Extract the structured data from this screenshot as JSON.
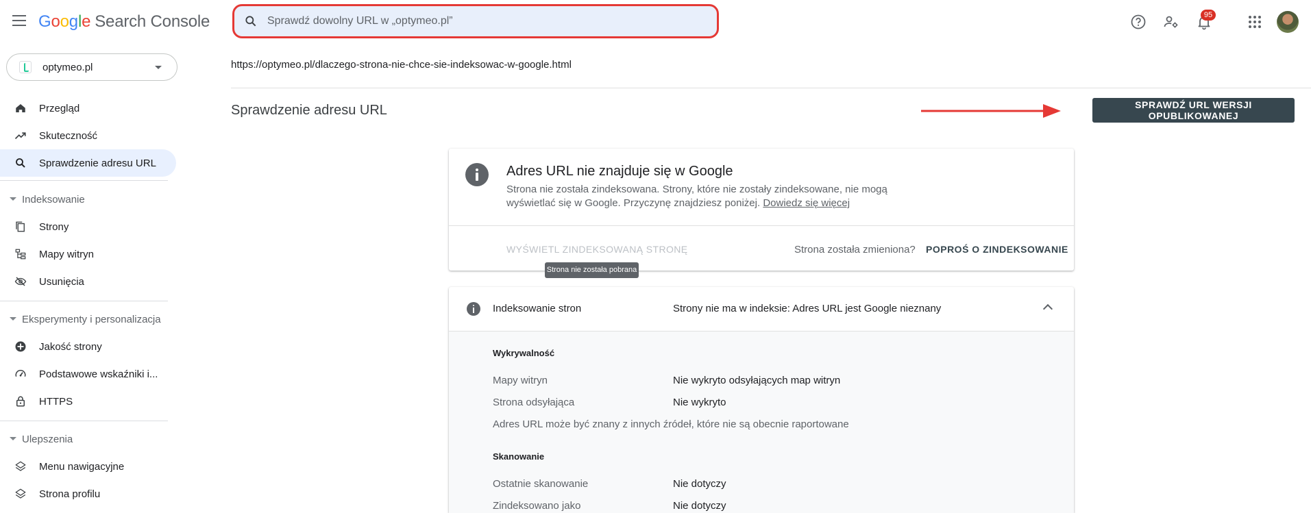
{
  "header": {
    "menu_icon": "menu-icon",
    "brand": {
      "g": "G",
      "o1": "o",
      "o2": "o",
      "g2": "g",
      "l": "l",
      "e": "e",
      "product": "Search Console"
    },
    "search_placeholder": "Sprawdź dowolny URL w „optymeo.pl”",
    "notifications_count": "95",
    "icons": [
      "help-icon",
      "manage-users-icon",
      "notifications-icon",
      "apps-grid-icon"
    ],
    "search_border_color": "#e53935"
  },
  "property": {
    "label": "optymeo.pl"
  },
  "sidebar": {
    "items_top": [
      {
        "label": "Przegląd",
        "icon": "home-icon"
      },
      {
        "label": "Skuteczność",
        "icon": "trending-up-icon"
      },
      {
        "label": "Sprawdzenie adresu URL",
        "icon": "search-icon",
        "active": true
      }
    ],
    "sections": [
      {
        "label": "Indeksowanie",
        "items": [
          {
            "label": "Strony",
            "icon": "pages-icon"
          },
          {
            "label": "Mapy witryn",
            "icon": "sitemap-icon"
          },
          {
            "label": "Usunięcia",
            "icon": "visibility-off-icon"
          }
        ]
      },
      {
        "label": "Eksperymenty i personalizacja",
        "items": [
          {
            "label": "Jakość strony",
            "icon": "add-circle-icon"
          },
          {
            "label": "Podstawowe wskaźniki i...",
            "icon": "speed-gauge-icon"
          },
          {
            "label": "HTTPS",
            "icon": "lock-icon"
          }
        ]
      },
      {
        "label": "Ulepszenia",
        "items": [
          {
            "label": "Menu nawigacyjne",
            "icon": "layers-icon"
          },
          {
            "label": "Strona profilu",
            "icon": "layers-icon"
          }
        ]
      }
    ]
  },
  "main": {
    "inspected_url": "https://optymeo.pl/dlaczego-strona-nie-chce-sie-indeksowac-w-google.html",
    "title": "Sprawdzenie adresu URL",
    "live_test_button": "SPRAWDŹ URL WERSJI OPUBLIKOWANEJ",
    "annotation_arrow_color": "#e53935",
    "status_card": {
      "title": "Adres URL nie znajduje się w Google",
      "description": "Strona nie została zindeksowana. Strony, które nie zostały zindeksowane, nie mogą wyświetlać się w Google. Przyczynę znajdziesz poniżej.",
      "learn_more": "Dowiedz się więcej",
      "view_indexed": "WYŚWIETL ZINDEKSOWANĄ STRONĘ",
      "changed_question": "Strona została zmieniona?",
      "request_indexing": "POPROŚ O ZINDEKSOWANIE",
      "tooltip": "Strona nie została pobrana"
    },
    "indexing_card": {
      "label": "Indeksowanie stron",
      "value": "Strony nie ma w indeksie: Adres URL jest Google nieznany",
      "discovery": {
        "heading": "Wykrywalność",
        "rows": [
          {
            "label": "Mapy witryn",
            "value": "Nie wykryto odsyłających map witryn"
          },
          {
            "label": "Strona odsyłająca",
            "value": "Nie wykryto"
          }
        ],
        "note": "Adres URL może być znany z innych źródeł, które nie są obecnie raportowane"
      },
      "crawl": {
        "heading": "Skanowanie",
        "rows": [
          {
            "label": "Ostatnie skanowanie",
            "value": "Nie dotyczy"
          },
          {
            "label": "Zindeksowano jako",
            "value": "Nie dotyczy"
          }
        ]
      }
    }
  }
}
